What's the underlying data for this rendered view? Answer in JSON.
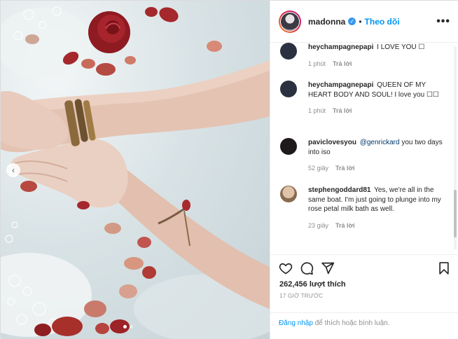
{
  "post": {
    "username": "madonna",
    "verified_mark": "✓",
    "separator": "•",
    "follow_label": "Theo dõi",
    "more_label": "•••",
    "likes_text": "262,456 lượt thích",
    "timestamp": "17 GIỜ TRƯỚC",
    "login_link": "Đăng nhập",
    "login_rest": " để thích hoặc bình luận.",
    "carousel_prev": "‹"
  },
  "comments": [
    {
      "user": "heychampagnepapi",
      "text": " I LOVE YOU ☐",
      "mention": "",
      "text_after": "",
      "time": "1 phút",
      "reply": "Trả lời",
      "avatar_color": "#2b3140"
    },
    {
      "user": "heychampagnepapi",
      "text": " QUEEN OF MY HEART BODY AND SOUL! I love you ☐☐",
      "mention": "",
      "text_after": "",
      "time": "1 phút",
      "reply": "Trả lời",
      "avatar_color": "#2b3140"
    },
    {
      "user": "paviclovesyou",
      "text": " ",
      "mention": "@genrickard",
      "text_after": " you two days into iso",
      "time": "52 giây",
      "reply": "Trả lời",
      "avatar_color": "#1e1a1c"
    },
    {
      "user": "stephengoddard81",
      "text": " Yes, we're all in the same boat. I'm just going to plunge into my rose petal milk bath as well.",
      "mention": "",
      "text_after": "",
      "time": "23 giây",
      "reply": "Trả lời",
      "avatar_color": "#c7a88a"
    }
  ],
  "icons": [
    "heart-icon",
    "comment-icon",
    "share-icon",
    "bookmark-icon",
    "verified-icon",
    "more-options-icon",
    "chevron-left-icon"
  ],
  "colors": {
    "link_blue": "#0095f6",
    "verified_blue": "#3897f0",
    "petal_red": "#a5282c",
    "muted_text": "#8e8e8e"
  }
}
